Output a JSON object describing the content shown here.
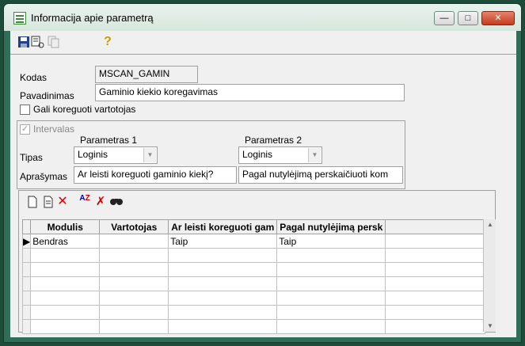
{
  "window": {
    "title": "Informacija apie parametrą"
  },
  "toolbar": {
    "save_icon": "save-icon",
    "properties_icon": "properties-icon",
    "copy_icon": "copy-icon",
    "help_icon": "help-icon"
  },
  "form": {
    "kodas_label": "Kodas",
    "kodas_value": "MSCAN_GAMIN",
    "pavadinimas_label": "Pavadinimas",
    "pavadinimas_value": "Gaminio kiekio koregavimas",
    "gali_label": "Gali koreguoti vartotojas",
    "gali_checked": false
  },
  "intervalas": {
    "label": "Intervalas",
    "checked": true,
    "param1_header": "Parametras 1",
    "param2_header": "Parametras 2",
    "tipas_label": "Tipas",
    "tipas1": "Loginis",
    "tipas2": "Loginis",
    "aprasymas_label": "Aprašymas",
    "aprasymas1": "Ar leisti koreguoti gaminio kiekį?",
    "aprasymas2": "Pagal nutylėjimą perskaičiuoti kom"
  },
  "grid": {
    "columns": [
      "Modulis",
      "Vartotojas",
      "Ar leisti koreguoti gam",
      "Pagal nutylėjimą persk"
    ],
    "rows": [
      [
        "Bendras",
        "",
        "Taip",
        "Taip"
      ]
    ]
  }
}
